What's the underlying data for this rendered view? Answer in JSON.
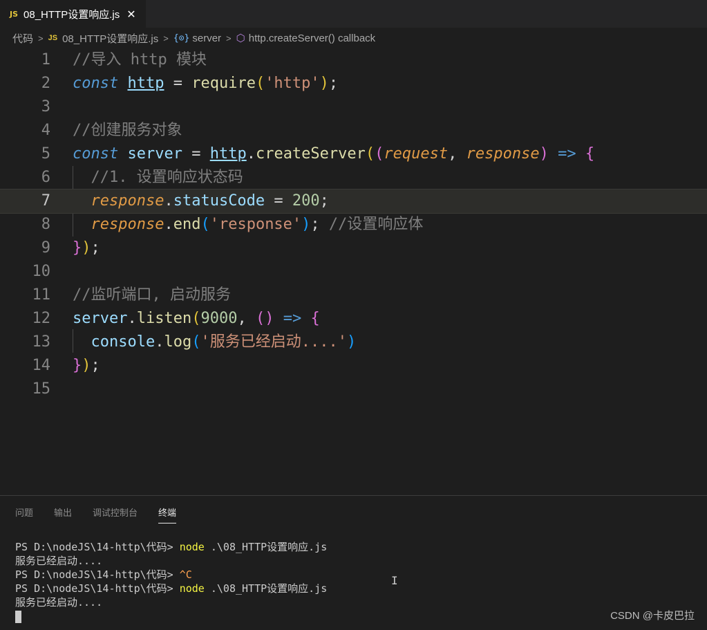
{
  "tab": {
    "badge": "JS",
    "title": "08_HTTP设置响应.js",
    "close_icon": "close-icon"
  },
  "breadcrumb": {
    "root": "代码",
    "file_badge": "JS",
    "file": "08_HTTP设置响应.js",
    "var_icon": "{⊙}",
    "var": "server",
    "method": "http.createServer() callback"
  },
  "editor": {
    "line_numbers": [
      "1",
      "2",
      "3",
      "4",
      "5",
      "6",
      "7",
      "8",
      "9",
      "10",
      "11",
      "12",
      "13",
      "14",
      "15"
    ],
    "active_line": "7",
    "code": {
      "l1": "//导入 http 模块",
      "l2_kw": "const",
      "l2_var": "http",
      "l2_eq": " = ",
      "l2_fn": "require",
      "l2_str": "'http'",
      "l4": "//创建服务对象",
      "l5_kw": "const",
      "l5_var": "server",
      "l5_eq": " = ",
      "l5_obj": "http",
      "l5_fn": "createServer",
      "l5_p1": "request",
      "l5_p2": "response",
      "l5_arrow": "=>",
      "l6": "//1. 设置响应状态码",
      "l7_obj": "response",
      "l7_prop": "statusCode",
      "l7_eq": " = ",
      "l7_num": "200",
      "l8_obj": "response",
      "l8_fn": "end",
      "l8_str": "'response'",
      "l8_cm": "//设置响应体",
      "l11": "//监听端口, 启动服务",
      "l12_obj": "server",
      "l12_fn": "listen",
      "l12_num": "9000",
      "l12_arrow": "=>",
      "l13_obj": "console",
      "l13_fn": "log",
      "l13_str": "'服务已经启动....'"
    }
  },
  "panel": {
    "tabs": [
      "问题",
      "输出",
      "调试控制台",
      "终端"
    ],
    "active_tab": "终端",
    "terminal": {
      "prompt": "PS D:\\nodeJS\\14-http\\代码> ",
      "line1_cmd": "node",
      "line1_arg": " .\\08_HTTP设置响应.js",
      "line2": "服务已经启动....",
      "line3_ctrl": "^C",
      "line4_cmd": "node",
      "line4_arg": " .\\08_HTTP设置响应.js",
      "line5": "服务已经启动...."
    }
  },
  "watermark": "CSDN @卡皮巴拉"
}
